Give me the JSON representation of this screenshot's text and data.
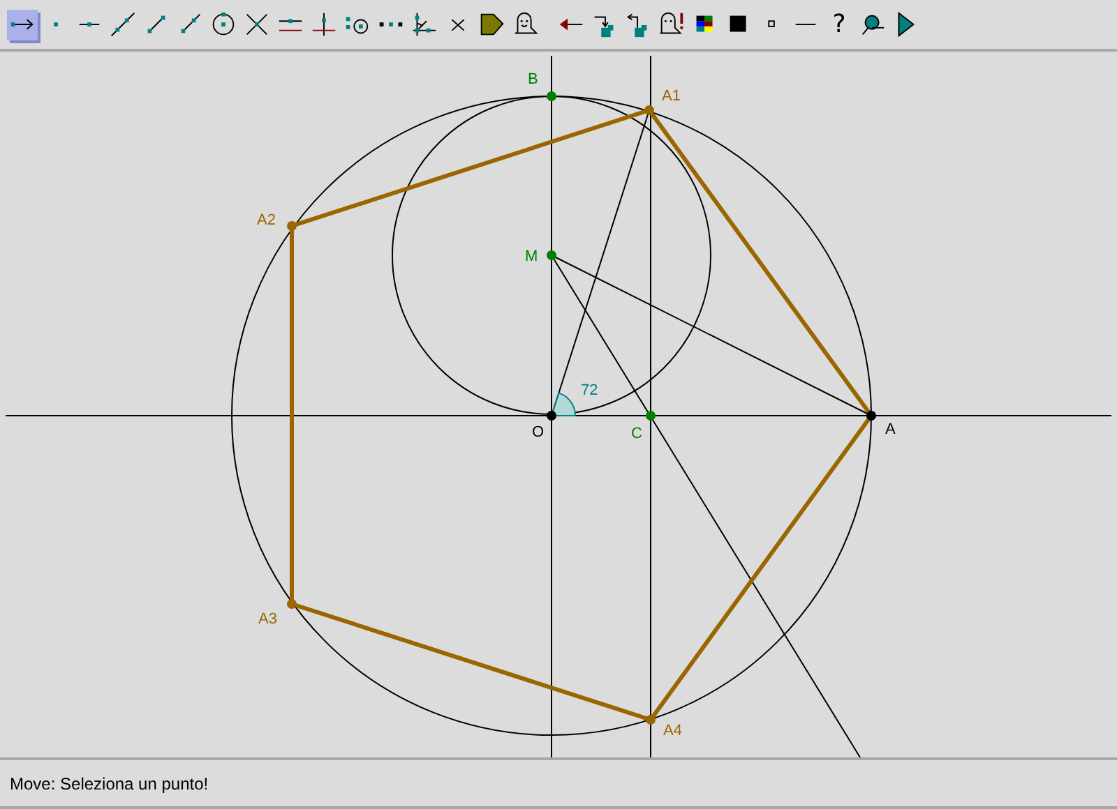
{
  "toolbar": {
    "tools": [
      {
        "selected": true
      },
      {
        "selected": false
      },
      {
        "selected": false
      },
      {
        "selected": false
      },
      {
        "selected": false
      },
      {
        "selected": false
      },
      {
        "selected": false
      },
      {
        "selected": false
      },
      {
        "selected": false
      },
      {
        "selected": false
      },
      {
        "selected": false
      },
      {
        "selected": false
      },
      {
        "selected": false
      },
      {
        "selected": false
      },
      {
        "selected": false
      },
      {
        "selected": false
      },
      {
        "selected": false
      },
      {
        "selected": false
      },
      {
        "selected": false
      },
      {
        "selected": false
      },
      {
        "selected": false
      },
      {
        "selected": false
      },
      {
        "selected": false
      },
      {
        "selected": false
      },
      {
        "selected": false,
        "glyph": "?"
      },
      {
        "selected": false
      },
      {
        "selected": false
      }
    ]
  },
  "canvas": {
    "points": [
      {
        "label": "O",
        "color": "#000000"
      },
      {
        "label": "A",
        "color": "#000000"
      },
      {
        "label": "B",
        "color": "#008000"
      },
      {
        "label": "M",
        "color": "#008000"
      },
      {
        "label": "C",
        "color": "#008000"
      },
      {
        "label": "A1",
        "color": "#996600"
      },
      {
        "label": "A2",
        "color": "#996600"
      },
      {
        "label": "A3",
        "color": "#996600"
      },
      {
        "label": "A4",
        "color": "#996600"
      }
    ],
    "angle": {
      "label": "72"
    }
  },
  "status_bar": {
    "text": "Move: Seleziona un punto!"
  }
}
